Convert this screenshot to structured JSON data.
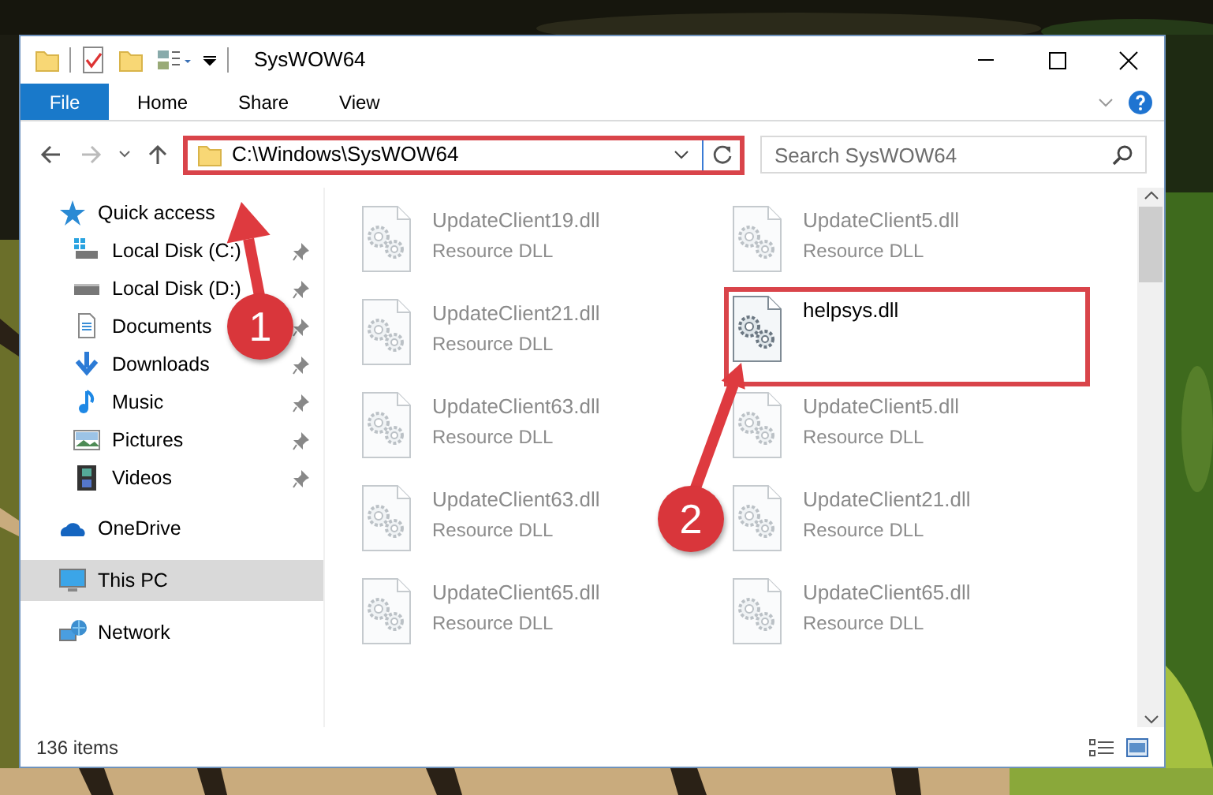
{
  "window": {
    "title": "SysWOW64"
  },
  "ribbon_tabs": [
    {
      "label": "File",
      "kind": "file"
    },
    {
      "label": "Home",
      "kind": "tab"
    },
    {
      "label": "Share",
      "kind": "tab"
    },
    {
      "label": "View",
      "kind": "tab"
    }
  ],
  "address_bar": {
    "path": "C:\\Windows\\SysWOW64",
    "highlighted": true
  },
  "search": {
    "placeholder": "Search SysWOW64"
  },
  "sidebar": {
    "items": [
      {
        "label": "Quick access",
        "selected": false,
        "children": [
          {
            "label": "Local Disk (C:)",
            "pinned": true
          },
          {
            "label": "Local Disk (D:)",
            "pinned": true
          },
          {
            "label": "Documents",
            "pinned": true
          },
          {
            "label": "Downloads",
            "pinned": true
          },
          {
            "label": "Music",
            "pinned": true
          },
          {
            "label": "Pictures",
            "pinned": true
          },
          {
            "label": "Videos",
            "pinned": true
          }
        ]
      },
      {
        "label": "OneDrive",
        "selected": false
      },
      {
        "label": "This PC",
        "selected": true
      },
      {
        "label": "Network",
        "selected": false
      }
    ]
  },
  "files": [
    {
      "name": "UpdateClient19.dll",
      "type": "Resource DLL",
      "blurred": true,
      "highlighted": false
    },
    {
      "name": "UpdateClient5.dll",
      "type": "Resource DLL",
      "blurred": true,
      "highlighted": false
    },
    {
      "name": "UpdateClient21.dll",
      "type": "Resource DLL",
      "blurred": true,
      "highlighted": false
    },
    {
      "name": "helpsys.dll",
      "blurred": false,
      "highlighted": true
    },
    {
      "name": "UpdateClient63.dll",
      "type": "Resource DLL",
      "blurred": true,
      "highlighted": false
    },
    {
      "name": "UpdateClient5.dll",
      "type": "Resource DLL",
      "blurred": true,
      "highlighted": false
    },
    {
      "name": "UpdateClient63.dll",
      "type": "Resource DLL",
      "blurred": true,
      "highlighted": false
    },
    {
      "name": "UpdateClient21.dll",
      "type": "Resource DLL",
      "blurred": true,
      "highlighted": false
    },
    {
      "name": "UpdateClient65.dll",
      "type": "Resource DLL",
      "blurred": true,
      "highlighted": false
    },
    {
      "name": "UpdateClient65.dll",
      "type": "Resource DLL",
      "blurred": true,
      "highlighted": false
    }
  ],
  "status_bar": {
    "text": "136 items"
  },
  "annotations": [
    {
      "label": "1"
    },
    {
      "label": "2"
    }
  ]
}
